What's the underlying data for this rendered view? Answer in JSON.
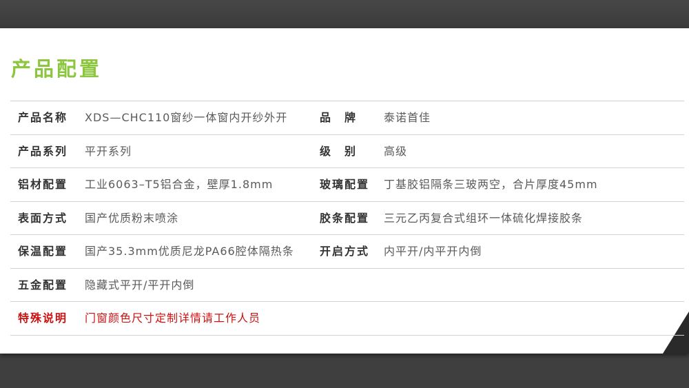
{
  "title": "产品配置",
  "rows": [
    {
      "label1": "产品名称",
      "value1": "XDS—CHC110窗纱一体窗内开纱外开",
      "label2": "品　牌",
      "value2": "泰诺首佳"
    },
    {
      "label1": "产品系列",
      "value1": "平开系列",
      "label2": "级　别",
      "value2": "高级"
    },
    {
      "label1": "铝材配置",
      "value1": "工业6063–T5铝合金，壁厚1.8mm",
      "label2": "玻璃配置",
      "value2": "丁基胶铝隔条三玻两空，合片厚度45mm"
    },
    {
      "label1": "表面方式",
      "value1": "国产优质粉末喷涂",
      "label2": "胶条配置",
      "value2": "三元乙丙复合式组环一体硫化焊接胶条"
    },
    {
      "label1": "保温配置",
      "value1": "国产35.3mm优质尼龙PA66腔体隔热条",
      "label2": "开启方式",
      "value2": "内平开/内平开内倒"
    },
    {
      "label1": "五金配置",
      "value1": "隐藏式平开/平开内倒"
    },
    {
      "label1": "特殊说明",
      "value1": "门窗颜色尺寸定制详情请工作人员"
    }
  ],
  "colors": {
    "title": "#8cc63f",
    "note": "#cc1111"
  }
}
